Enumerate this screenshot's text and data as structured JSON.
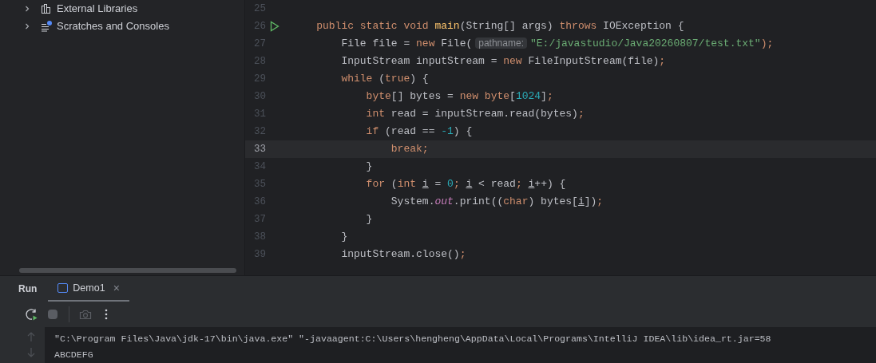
{
  "project_tree": {
    "items": [
      {
        "label": "External Libraries",
        "kind": "libraries",
        "expanded": false
      },
      {
        "label": "Scratches and Consoles",
        "kind": "scratches",
        "expanded": false
      }
    ]
  },
  "editor": {
    "lines": [
      {
        "number": "25",
        "current": false,
        "runnable": false
      },
      {
        "number": "26",
        "current": false,
        "runnable": true,
        "tokens": [
          {
            "t": "    public static void ",
            "kind": "keyword"
          },
          {
            "t": "main",
            "kind": "method"
          },
          {
            "t": "(String[] args) ",
            "kind": "plain"
          },
          {
            "t": "throws ",
            "kind": "keyword"
          },
          {
            "t": "IOException {",
            "kind": "plain"
          }
        ]
      },
      {
        "number": "27",
        "current": false,
        "runnable": false,
        "tokens": [
          {
            "t": "        File file = ",
            "kind": "plain"
          },
          {
            "t": "new ",
            "kind": "keyword"
          },
          {
            "t": "File(",
            "kind": "plain"
          },
          {
            "t": "pathname:",
            "kind": "hint"
          },
          {
            "t": "\"E:/javastudio/Java20260807/test.txt\"",
            "kind": "string"
          },
          {
            "t": ");",
            "kind": "punct"
          }
        ]
      },
      {
        "number": "28",
        "current": false,
        "runnable": false,
        "tokens": [
          {
            "t": "        InputStream inputStream = ",
            "kind": "plain"
          },
          {
            "t": "new ",
            "kind": "keyword"
          },
          {
            "t": "FileInputStream(file)",
            "kind": "plain"
          },
          {
            "t": ";",
            "kind": "punct"
          }
        ]
      },
      {
        "number": "29",
        "current": false,
        "runnable": false,
        "tokens": [
          {
            "t": "        while ",
            "kind": "keyword"
          },
          {
            "t": "(",
            "kind": "plain"
          },
          {
            "t": "true",
            "kind": "keyword"
          },
          {
            "t": ") {",
            "kind": "plain"
          }
        ]
      },
      {
        "number": "30",
        "current": false,
        "runnable": false,
        "tokens": [
          {
            "t": "            byte",
            "kind": "keyword"
          },
          {
            "t": "[] bytes = ",
            "kind": "plain"
          },
          {
            "t": "new byte",
            "kind": "keyword"
          },
          {
            "t": "[",
            "kind": "plain"
          },
          {
            "t": "1024",
            "kind": "number"
          },
          {
            "t": "]",
            "kind": "plain"
          },
          {
            "t": ";",
            "kind": "punct"
          }
        ]
      },
      {
        "number": "31",
        "current": false,
        "runnable": false,
        "tokens": [
          {
            "t": "            int ",
            "kind": "keyword"
          },
          {
            "t": "read = inputStream.read(bytes)",
            "kind": "plain"
          },
          {
            "t": ";",
            "kind": "punct"
          }
        ]
      },
      {
        "number": "32",
        "current": false,
        "runnable": false,
        "tokens": [
          {
            "t": "            if ",
            "kind": "keyword"
          },
          {
            "t": "(read == ",
            "kind": "plain"
          },
          {
            "t": "-1",
            "kind": "number"
          },
          {
            "t": ") {",
            "kind": "plain"
          }
        ]
      },
      {
        "number": "33",
        "current": true,
        "runnable": false,
        "tokens": [
          {
            "t": "                break;",
            "kind": "keyword"
          }
        ]
      },
      {
        "number": "34",
        "current": false,
        "runnable": false,
        "tokens": [
          {
            "t": "            }",
            "kind": "plain"
          }
        ]
      },
      {
        "number": "35",
        "current": false,
        "runnable": false,
        "tokens": [
          {
            "t": "            for ",
            "kind": "keyword"
          },
          {
            "t": "(",
            "kind": "plain"
          },
          {
            "t": "int ",
            "kind": "keyword"
          },
          {
            "t": "i",
            "kind": "var"
          },
          {
            "t": " = ",
            "kind": "plain"
          },
          {
            "t": "0",
            "kind": "number"
          },
          {
            "t": "; ",
            "kind": "punct"
          },
          {
            "t": "i",
            "kind": "var"
          },
          {
            "t": " < read",
            "kind": "plain"
          },
          {
            "t": "; ",
            "kind": "punct"
          },
          {
            "t": "i",
            "kind": "var"
          },
          {
            "t": "++) {",
            "kind": "plain"
          }
        ]
      },
      {
        "number": "36",
        "current": false,
        "runnable": false,
        "tokens": [
          {
            "t": "                System.",
            "kind": "plain"
          },
          {
            "t": "out",
            "kind": "static"
          },
          {
            "t": ".print((",
            "kind": "plain"
          },
          {
            "t": "char",
            "kind": "keyword"
          },
          {
            "t": ") bytes[",
            "kind": "plain"
          },
          {
            "t": "i",
            "kind": "var"
          },
          {
            "t": "])",
            "kind": "plain"
          },
          {
            "t": ";",
            "kind": "punct"
          }
        ]
      },
      {
        "number": "37",
        "current": false,
        "runnable": false,
        "tokens": [
          {
            "t": "            }",
            "kind": "plain"
          }
        ]
      },
      {
        "number": "38",
        "current": false,
        "runnable": false,
        "tokens": [
          {
            "t": "        }",
            "kind": "plain"
          }
        ]
      },
      {
        "number": "39",
        "current": false,
        "runnable": false,
        "tokens": [
          {
            "t": "        inputStream.close()",
            "kind": "plain"
          },
          {
            "t": ";",
            "kind": "punct"
          }
        ]
      }
    ]
  },
  "run_panel": {
    "title": "Run",
    "tabs": [
      {
        "label": "Demo1",
        "selected": true,
        "close": "×"
      }
    ],
    "toolbar": [
      {
        "kind": "rerun",
        "disabled": false
      },
      {
        "kind": "stop",
        "disabled": true
      },
      {
        "kind": "camera",
        "disabled": true
      },
      {
        "kind": "more",
        "disabled": false
      }
    ],
    "console": [
      "\"C:\\Program Files\\Java\\jdk-17\\bin\\java.exe\" \"-javaagent:C:\\Users\\hengheng\\AppData\\Local\\Programs\\IntelliJ IDEA\\lib\\idea_rt.jar=58",
      "ABCDEFG"
    ]
  }
}
